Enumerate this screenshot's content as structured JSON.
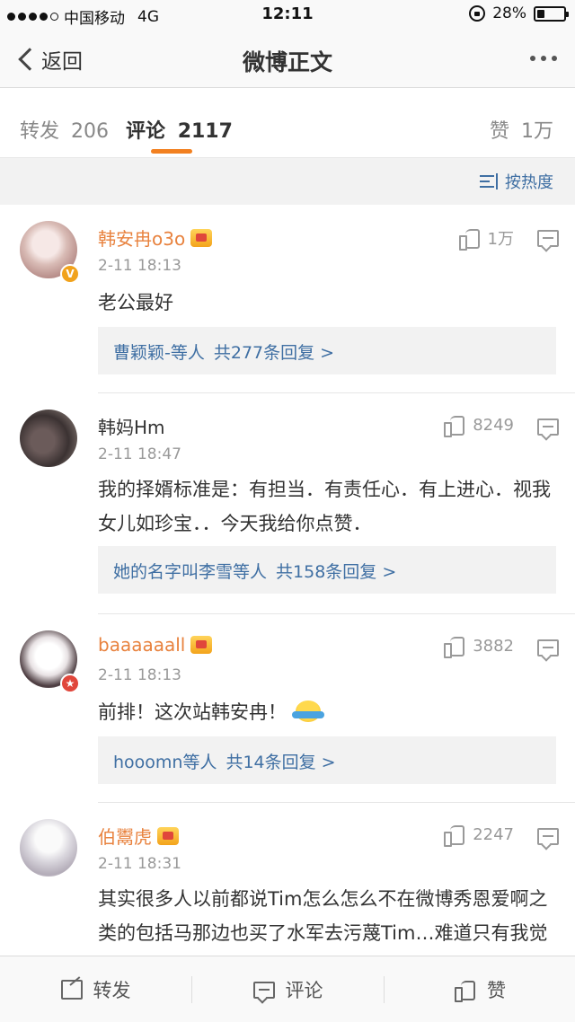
{
  "status_bar": {
    "carrier": "中国移动",
    "network": "4G",
    "time": "12:11",
    "battery": "28%",
    "battery_level": 0.28
  },
  "nav": {
    "back_label": "返回",
    "title": "微博正文"
  },
  "tabs": {
    "repost_label": "转发",
    "repost_count": "206",
    "comment_label": "评论",
    "comment_count": "2117",
    "like_label": "赞",
    "like_count": "1万"
  },
  "sort": {
    "label": "按热度"
  },
  "comments": [
    {
      "name": "韩安冉o3o",
      "time": "2-11 18:13",
      "likes": "1万",
      "text": "老公最好",
      "reply_users": "曹颖颖-等人",
      "reply_count": "共277条回复 >"
    },
    {
      "name": "韩妈Hm",
      "time": "2-11 18:47",
      "likes": "8249",
      "text": "我的择婿标准是：有担当．有责任心．有上进心．视我女儿如珍宝．．今天我给你点赞．",
      "reply_users": "她的名字叫李雪等人",
      "reply_count": "共158条回复 >"
    },
    {
      "name": "baaaaaall",
      "time": "2-11 18:13",
      "likes": "3882",
      "text": "前排！这次站韩安冉！",
      "reply_users": "hooomn等人",
      "reply_count": "共14条回复 >"
    },
    {
      "name": "伯鬻虎",
      "time": "2-11 18:31",
      "likes": "2247",
      "text": "其实很多人以前都说Tim怎么怎么不在微博秀恩爱啊之类的包括马那边也买了水军去污蔑Tim…难道只有我觉得Tim这样才是真正爱韩安冉的吗？不经"
    }
  ],
  "toolbar": {
    "repost": "转发",
    "comment": "评论",
    "like": "赞"
  },
  "colors": {
    "accent_orange": "#f28020",
    "link_blue": "#3f6fa3",
    "vip_name": "#e8823e"
  }
}
